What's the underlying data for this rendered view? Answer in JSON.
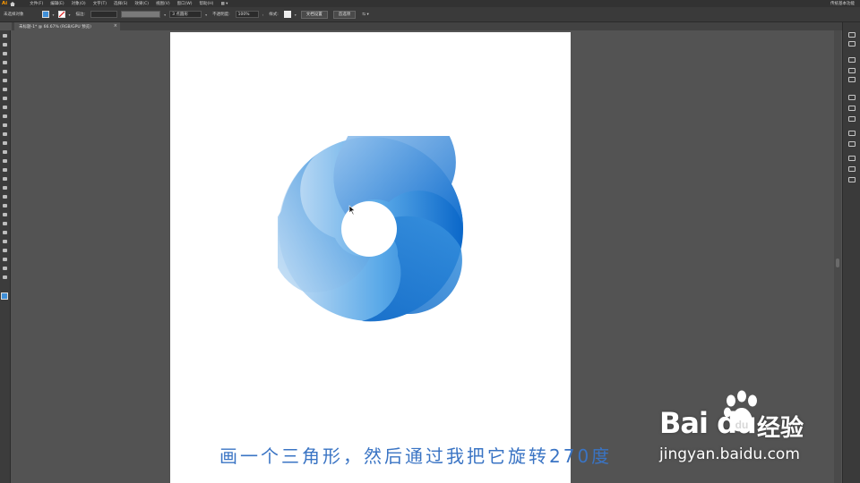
{
  "app": {
    "logo": "Ai"
  },
  "menubar": {
    "items": [
      "文件(F)",
      "编辑(E)",
      "对象(O)",
      "文字(T)",
      "选择(S)",
      "效果(C)",
      "视图(V)",
      "窗口(W)",
      "帮助(H)"
    ],
    "right_label": "传统基本功能"
  },
  "controlbar": {
    "selection_label": "未选择对象",
    "stroke_label": "描边:",
    "brush_value": "3 点圆形",
    "opacity_label": "不透明度:",
    "opacity_value": "100%",
    "style_label": "样式:",
    "doc_setup_button": "文档设置",
    "preferences_button": "首选项"
  },
  "document_tab": {
    "title": "未标题-1* @ 66.67% (RGB/GPU 预览)",
    "close": "×"
  },
  "caption": {
    "text": "画一个三角形，然后通过我把它旋转270度"
  },
  "watermark": {
    "brand": "Bai  du",
    "cn": "经验",
    "url": "jingyan.baidu.com"
  },
  "colors": {
    "logo_light": "#cfe3f6",
    "logo_mid": "#4ea3e6",
    "logo_dark": "#0a67c9",
    "caption": "#3a74c4",
    "canvas": "#535353"
  },
  "icons": {
    "tools": [
      "selection-tool-icon",
      "direct-selection-tool-icon",
      "magic-wand-icon",
      "lasso-icon",
      "pen-tool-icon",
      "curvature-icon",
      "type-tool-icon",
      "line-tool-icon",
      "ellipse-tool-icon",
      "paintbrush-icon",
      "pencil-icon",
      "eraser-icon",
      "rotate-tool-icon",
      "scale-tool-icon",
      "width-tool-icon",
      "free-transform-icon",
      "shape-builder-icon",
      "perspective-icon",
      "mesh-icon",
      "gradient-icon",
      "eyedropper-icon",
      "blend-icon",
      "symbol-sprayer-icon",
      "column-graph-icon",
      "artboard-tool-icon",
      "slice-icon",
      "hand-tool-icon",
      "zoom-tool-icon"
    ],
    "right_panel": [
      "color-panel-icon",
      "color-guide-icon",
      "swatches-icon",
      "brushes-icon",
      "symbols-icon",
      "stroke-panel-icon",
      "gradient-panel-icon",
      "transparency-icon",
      "appearance-icon",
      "graphic-styles-icon",
      "layers-icon",
      "asset-export-icon",
      "artboards-panel-icon"
    ]
  }
}
